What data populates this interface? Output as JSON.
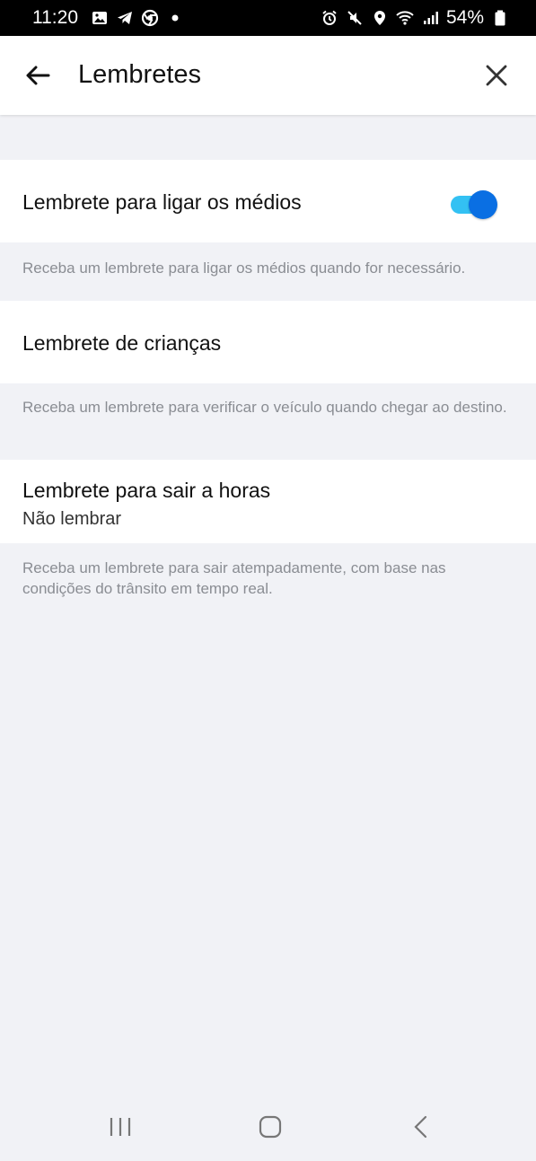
{
  "status_bar": {
    "time": "11:20",
    "battery": "54%",
    "left_icons": [
      "gallery-icon",
      "telegram-icon",
      "chrome-icon",
      "dot-icon"
    ],
    "right_icons": [
      "alarm-icon",
      "mute-icon",
      "location-icon",
      "wifi-icon",
      "signal-icon",
      "battery-icon"
    ]
  },
  "header": {
    "title": "Lembretes",
    "back_icon": "back-arrow-icon",
    "close_icon": "close-icon"
  },
  "settings": [
    {
      "title": "Lembrete para ligar os médios",
      "toggle_on": true,
      "description": "Receba um lembrete para ligar os médios quando for necessário."
    },
    {
      "title": "Lembrete de crianças",
      "description": "Receba um lembrete para verificar o veículo quando chegar ao destino."
    },
    {
      "title": "Lembrete para sair a horas",
      "value": "Não lembrar",
      "description": "Receba um lembrete para sair atempadamente, com base nas condições do trânsito em tempo real."
    }
  ],
  "colors": {
    "toggle_track": "#33c1f3",
    "toggle_knob": "#0a6fe3",
    "background": "#f1f2f6"
  },
  "nav_bar": {
    "icons": [
      "recent-apps-icon",
      "home-icon",
      "back-icon"
    ]
  }
}
